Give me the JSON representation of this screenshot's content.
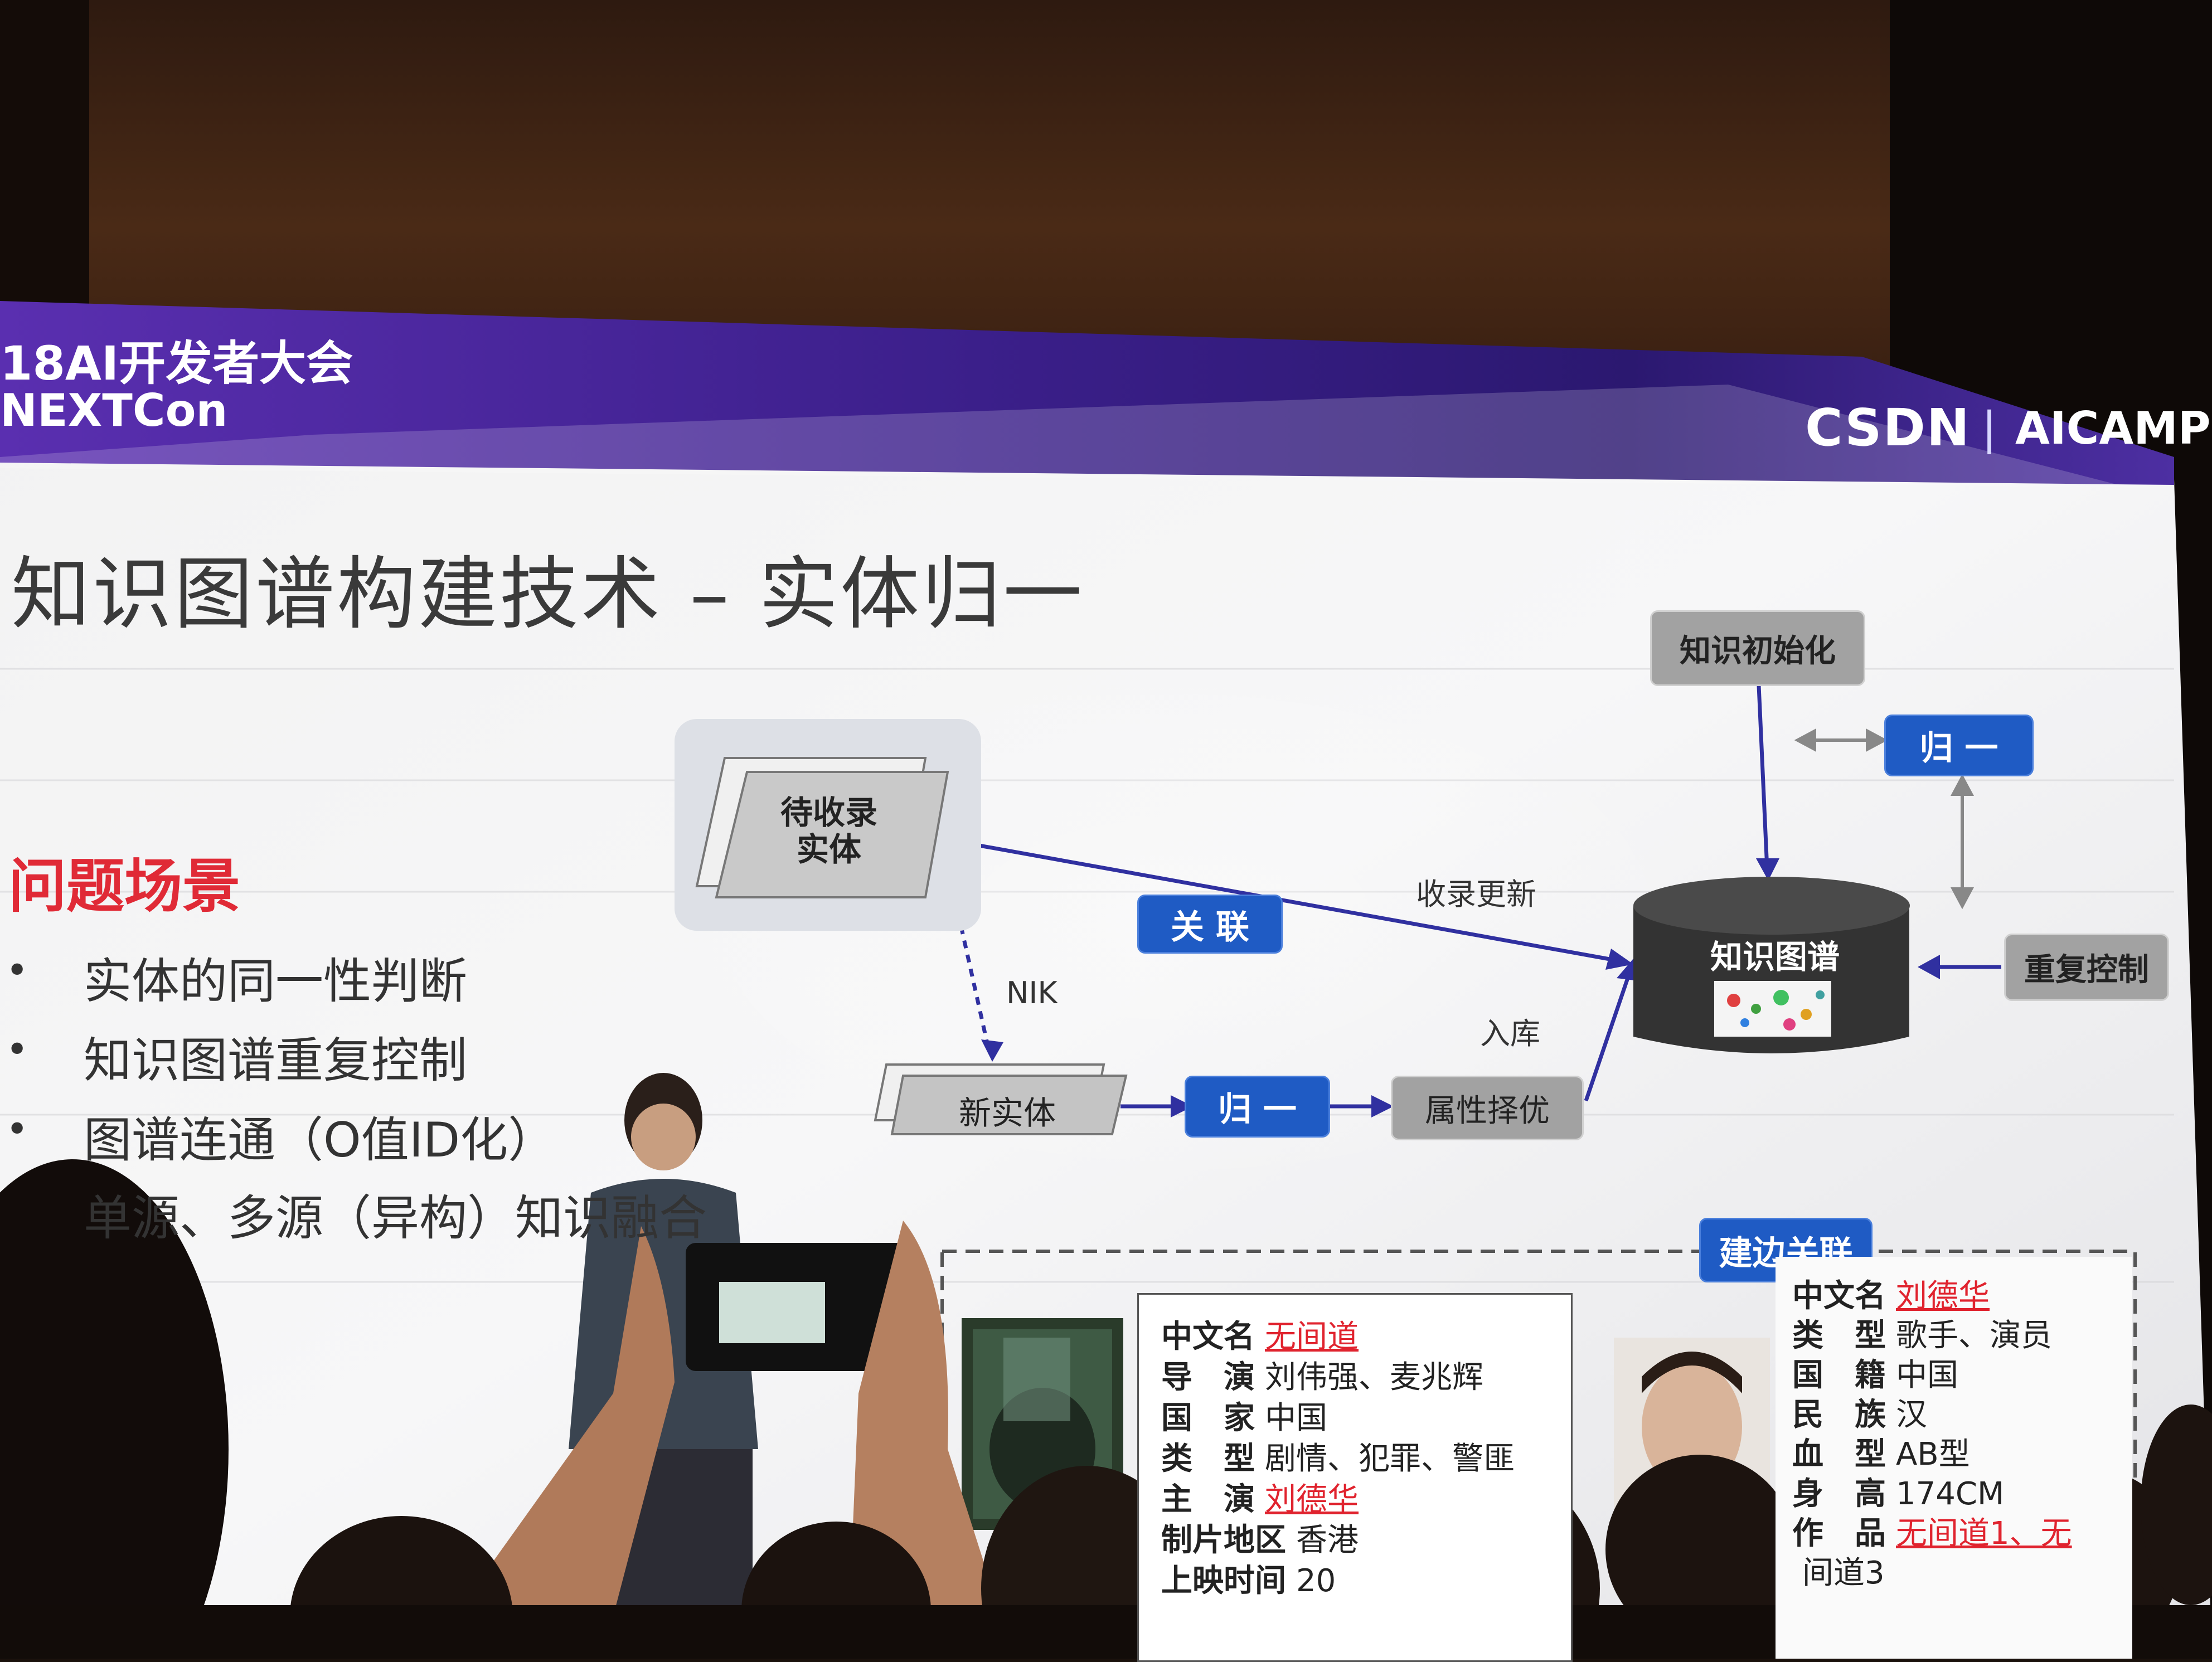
{
  "conference": {
    "line1": "18AI开发者大会",
    "line2": "NEXTCon"
  },
  "logos": {
    "csdn": "CSDN",
    "separator": "|",
    "camp": "AICAMP"
  },
  "slide_title": "知识图谱构建技术 – 实体归一",
  "section_heading": "问题场景",
  "bullets": [
    "实体的同一性判断",
    "知识图谱重复控制",
    "图谱连通（O值ID化）",
    "单源、多源（异构）知识融合"
  ],
  "diagram": {
    "pending_entity": "待收录\n实体",
    "link_button": "关 联",
    "include_update": "收录更新",
    "nik": "NIK",
    "new_entity": "新实体",
    "normalize_bottom": "归 一",
    "attr_select": "属性择优",
    "store": "入库",
    "knowledge_graph": "知识图谱",
    "kg_init": "知识初始化",
    "normalize_top": "归 一",
    "dup_control": "重复控制",
    "edge_link": "建边关联"
  },
  "movie_card": {
    "rows": [
      {
        "k": "中文名",
        "v": "无间道",
        "link": true
      },
      {
        "k": "导　演",
        "v": "刘伟强、麦兆辉",
        "link": false
      },
      {
        "k": "国　家",
        "v": "中国",
        "link": false
      },
      {
        "k": "类　型",
        "v": "剧情、犯罪、警匪",
        "link": false
      },
      {
        "k": "主　演",
        "v": "刘德华",
        "link": true
      },
      {
        "k": "制片地区",
        "v": "香港",
        "link": false
      },
      {
        "k": "上映时间",
        "v": "20",
        "link": false
      }
    ]
  },
  "person_card": {
    "rows": [
      {
        "k": "中文名",
        "v": "刘德华",
        "link": true
      },
      {
        "k": "类　型",
        "v": "歌手、演员",
        "link": false
      },
      {
        "k": "国　籍",
        "v": "中国",
        "link": false
      },
      {
        "k": "民　族",
        "v": "汉",
        "link": false
      },
      {
        "k": "血　型",
        "v": "AB型",
        "link": false
      },
      {
        "k": "身　高",
        "v": "174CM",
        "link": false
      },
      {
        "k": "作　品",
        "v": "无间道1、无",
        "link": true
      },
      {
        "k": "",
        "v": "间道3",
        "link": false
      }
    ]
  },
  "colors": {
    "accent_red": "#e02a36",
    "node_blue": "#1f5bc4",
    "header_purple": "#4a2a9a"
  }
}
